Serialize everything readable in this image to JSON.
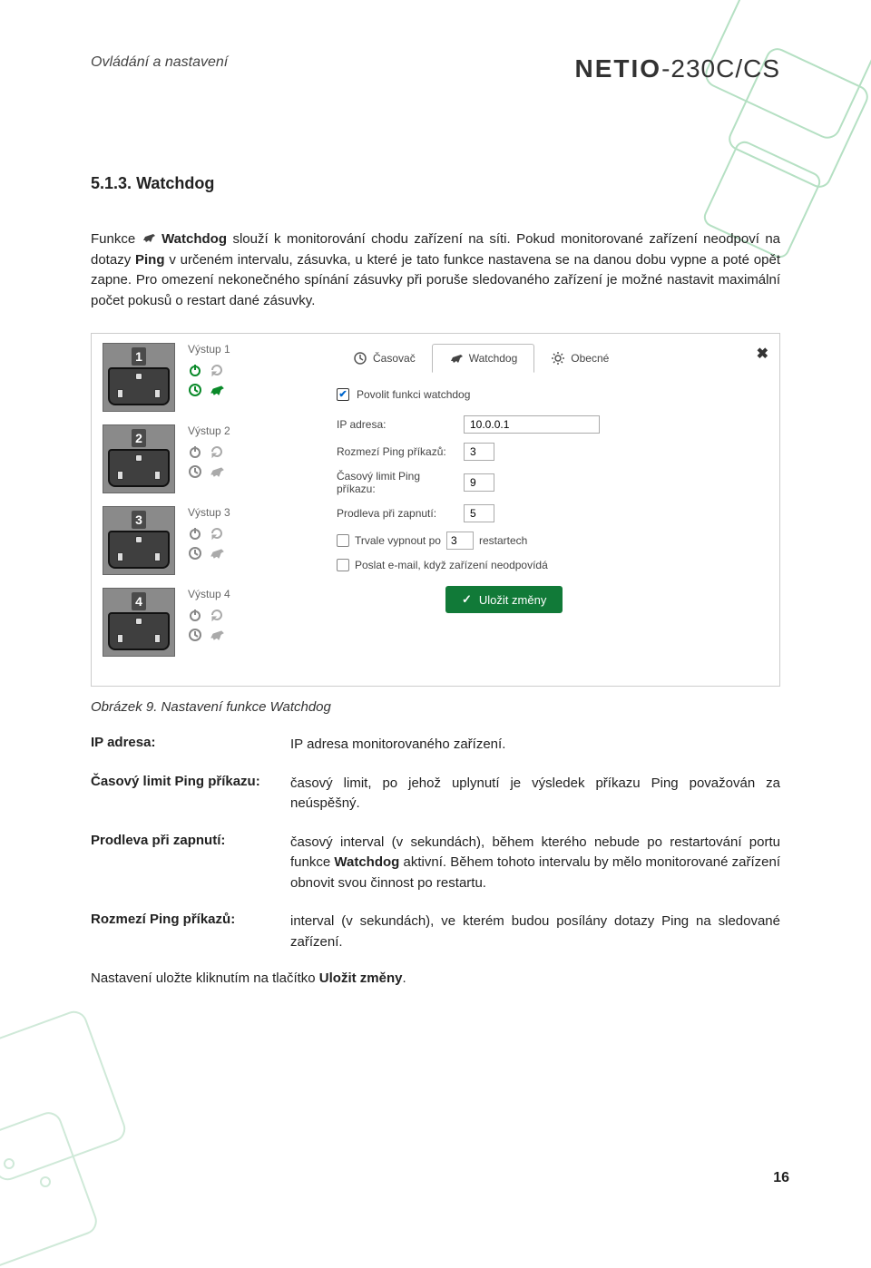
{
  "header": {
    "breadcrumb": "Ovládání a nastavení",
    "logo_main": "NETIO",
    "logo_sub": "-230C/CS"
  },
  "section": {
    "number": "5.1.3.",
    "title": "Watchdog"
  },
  "intro": {
    "pre": "Funkce ",
    "bold1": "Watchdog",
    "mid1": " slouží k monitorování chodu zařízení na síti. Pokud monitorované zařízení neodpoví na dotazy ",
    "bold2": "Ping",
    "mid2": " v určeném intervalu, zásuvka, u které je tato funkce nastavena se na danou dobu vypne a poté opět zapne. Pro omezení nekonečného spínání zásuvky při poruše sledovaného zařízení je možné nastavit maximální počet pokusů o restart dané zásuvky."
  },
  "screenshot": {
    "outlets": [
      {
        "num": "1",
        "label": "Výstup 1",
        "active": true
      },
      {
        "num": "2",
        "label": "Výstup 2",
        "active": false
      },
      {
        "num": "3",
        "label": "Výstup 3",
        "active": false
      },
      {
        "num": "4",
        "label": "Výstup 4",
        "active": false
      }
    ],
    "tabs": {
      "timer": {
        "label": "Časovač"
      },
      "watchdog": {
        "label": "Watchdog"
      },
      "general": {
        "label": "Obecné"
      }
    },
    "close_icon": "✖",
    "form": {
      "enable_label": "Povolit funkci watchdog",
      "ip_label": "IP adresa:",
      "ip_value": "10.0.0.1",
      "range_label": "Rozmezí Ping příkazů:",
      "range_value": "3",
      "timeout_label": "Časový limit Ping příkazu:",
      "timeout_value": "9",
      "delay_label": "Prodleva při zapnutí:",
      "delay_value": "5",
      "perm_off_pre": "Trvale vypnout po",
      "perm_off_value": "3",
      "perm_off_post": "restartech",
      "email_label": "Poslat e-mail, když zařízení neodpovídá",
      "save_label": "Uložit změny"
    }
  },
  "caption": "Obrázek 9. Nastavení funkce Watchdog",
  "definitions": [
    {
      "term": "IP adresa:",
      "desc_pre": "IP adresa monitorovaného zařízení.",
      "bold": "",
      "desc_post": ""
    },
    {
      "term": "Časový limit Ping příkazu:",
      "desc_pre": "časový limit, po jehož uplynutí je výsledek příkazu Ping považován za neúspěšný.",
      "bold": "",
      "desc_post": ""
    },
    {
      "term": "Prodleva při zapnutí:",
      "desc_pre": "časový interval (v sekundách), během kterého nebude po restartování portu funkce ",
      "bold": "Watchdog",
      "desc_post": " aktivní. Během tohoto intervalu by mělo monitorované zařízení obnovit svou činnost po restartu."
    },
    {
      "term": "Rozmezí Ping příkazů:",
      "desc_pre": "interval (v sekundách), ve kterém budou posílány dotazy Ping na sledované zařízení.",
      "bold": "",
      "desc_post": ""
    }
  ],
  "outro_pre": "Nastavení uložte kliknutím na tlačítko ",
  "outro_bold": "Uložit změny",
  "outro_post": ".",
  "page_number": "16"
}
